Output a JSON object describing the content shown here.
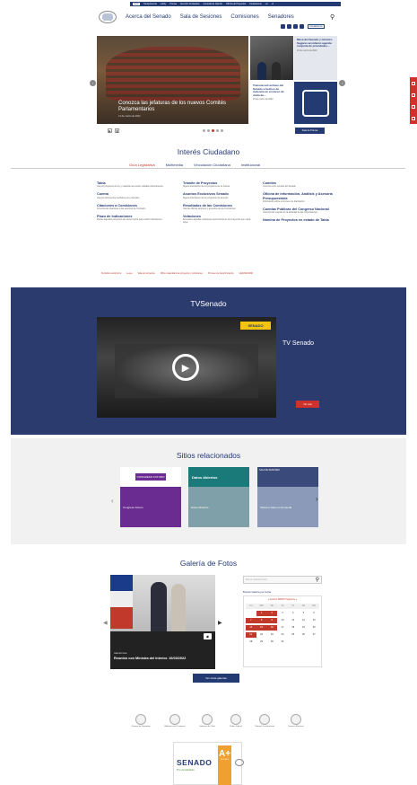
{
  "topbar": {
    "links": [
      "Inicio",
      "Transparencia",
      "Lobby",
      "Prensa",
      "Atención Ciudadana",
      "Consulta de Opinión",
      "Oficina de Proyectos",
      "Contáctenos",
      "+A",
      "-A"
    ]
  },
  "nav": {
    "items": [
      "Acerca del Senado",
      "Sala de Sesiones",
      "Comisiones",
      "Senadores"
    ],
    "contact_label": "Contáctenos"
  },
  "hero": {
    "title": "Conozca las jefaturas de los nuevos Comités Parlamentarios",
    "date": "21 de marzo de 2022",
    "side1_title": "Mesa del Senado y ministro Segpres acordaron agenda conjunta de prioridades...",
    "side1_date": "23 de marzo de 2022",
    "side2_title": "Transversal rechazo del Senado a hechos de violencia en el marco de visita de...",
    "side2_date": "23 de marzo de 2022",
    "press_room_label": "Sala de Prensa"
  },
  "interes": {
    "title": "Interés Ciudadano",
    "tabs": [
      "Guía Legislativa",
      "Multimedia",
      "Vinculación Ciudadana",
      "Institucional"
    ],
    "col1": [
      {
        "title": "Tabla",
        "desc": "Vea los proyectos de ley y materias que serán votadas próximamente"
      },
      {
        "title": "Cuenta",
        "desc": "Vea los documentos recibidos por el Senado"
      },
      {
        "title": "Citaciones a Comisiones",
        "desc": "Conozca las citaciones a las sesiones de Comisión"
      },
      {
        "title": "Plazo de Indicaciones",
        "desc": "Revise aquellos proyectos que tienen fecha para recibir indicaciones"
      }
    ],
    "col2": [
      {
        "title": "Trámite de Proyectos",
        "desc": "Siga la tramitación de los proyectos de su interés"
      },
      {
        "title": "Asuntos Exclusivos Senado",
        "desc": "Siga la tramitación de los proyectos de acuerdo"
      },
      {
        "title": "Resultados de las Comisiones",
        "desc": "Vea las últimas sesiones y acuerdos de las Comisiones"
      },
      {
        "title": "Votaciones",
        "desc": "Encuentre aquellas votaciones electrónicas de los proyectos que usted sigue"
      }
    ],
    "col3": [
      {
        "title": "Comités",
        "desc": "Conozca a los comités del Senado"
      },
      {
        "title": "Oficina de Información, Análisis y Asesoría Presupuestaria",
        "desc": "Información sobre el proceso de tramitación"
      },
      {
        "title": "Cuentas Públicas del Congreso Nacional",
        "desc": "Conozca las cuentas de la actividad de las corporaciones"
      },
      {
        "title": "Nómina de Proyectos en estado de Tabla",
        "desc": ""
      }
    ],
    "bottom_links": [
      "Periódico electrónico",
      "Leyes",
      "Sala de proyectos",
      "Último calendario de proyectos y comisiones",
      "Proceso de transformación",
      "LEGISRADAR"
    ]
  },
  "tv": {
    "title": "TVSenado",
    "logo": "SENADO",
    "label": "TV Senado",
    "more_label": "Ver más"
  },
  "sitios": {
    "title": "Sitios relacionados",
    "cards": [
      {
        "label": "Congreso Futuro",
        "color": "#6a2c91",
        "head": "CONGRESO FUTURO"
      },
      {
        "label": "Datos Abiertos",
        "color": "#1a7a7a",
        "head": "Datos Abiertos"
      },
      {
        "label": "Sistema Sala en demanda",
        "color": "#3a4a7a",
        "head": "SALA DE SESIONES"
      }
    ]
  },
  "galeria": {
    "title": "Galería de Fotos",
    "category": "Galería Fotos",
    "caption": "Reunión con Ministra del Interior. 16/03/2022",
    "more_label": "Ver otras galerías",
    "search_placeholder": "Buscar Galerías Fotos",
    "date_search_label": "Buscar Galería por fecha",
    "calendar_header": "« Anterior MARZO Siguiente »",
    "weekdays": [
      "LU",
      "MA",
      "MI",
      "JU",
      "VI",
      "SA",
      "DO"
    ],
    "days": [
      "",
      "1",
      "2",
      "3",
      "4",
      "5",
      "6",
      "7",
      "8",
      "9",
      "10",
      "11",
      "12",
      "13",
      "14",
      "15",
      "16",
      "17",
      "18",
      "19",
      "20",
      "21",
      "22",
      "23",
      "24",
      "25",
      "26",
      "27",
      "28",
      "29",
      "30",
      "31",
      "",
      "",
      ""
    ],
    "highlighted_days": [
      "1",
      "2",
      "7",
      "8",
      "9",
      "14",
      "15",
      "16",
      "21"
    ]
  },
  "footer": {
    "institutions": [
      "Cámara de Diputados",
      "Biblioteca del Congreso",
      "Gobierno de Chile",
      "Poder Judicial",
      "Tribunal Constitucional",
      "Servicio Electoral"
    ],
    "cert_name": "SENADO",
    "cert_sub": "Pro Acreditado",
    "cert_badge": "A+",
    "cert_badge_text": "ISO 9001"
  }
}
